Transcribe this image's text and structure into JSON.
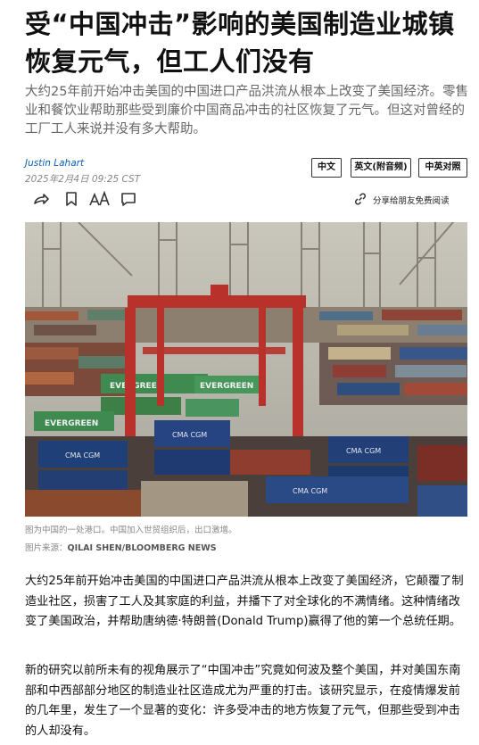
{
  "article": {
    "headline": "受“中国冲击”影响的美国制造业城镇恢复元气，但工人们没有",
    "dek": "大约25年前开始冲击美国的中国进口产品洪流从根本上改变了美国经济。零售业和餐饮业帮助那些受到廉价中国商品冲击的社区恢复了元气。但这对曾经的工厂工人来说并没有多大帮助。",
    "author": "Justin Lahart",
    "date": "2025年2月4日 09:25 CST",
    "languages": [
      "中文",
      "英文(附音频)",
      "中英对照"
    ],
    "toolbar": {
      "icons": [
        "share-arrow-icon",
        "bookmark-icon",
        "text-size-icon",
        "comment-icon"
      ],
      "gift_label": "分享给朋友免费阅读"
    },
    "photo": {
      "caption": "图为中国的一处港口。中国加入世贸组织后，出口激增。",
      "credit_prefix": "图片来源：",
      "credit_name": "QILAI SHEN/BLOOMBERG NEWS",
      "container_texts": [
        "EVERGREEN",
        "CMA CGM"
      ]
    },
    "paragraphs": [
      "大约25年前开始冲击美国的中国进口产品洪流从根本上改变了美国经济，它颠覆了制造业社区，损害了工人及其家庭的利益，并播下了对全球化的不满情绪。这种情绪改变了美国政治，并帮助唐纳德·特朗普(Donald Trump)赢得了他的第一个总统任期。",
      "新的研究以前所未有的视角展示了“中国冲击”究竟如何波及整个美国，并对美国东南部和中西部部分地区的制造业社区造成尤为严重的打击。该研究显示，在疫情爆发前的几年里，发生了一个显著的变化：许多受冲击的地方恢复了元气，但那些受到冲击的人却没有。"
    ]
  },
  "colors": {
    "author_link": "#0a5fb4",
    "muted_text": "#666666",
    "crane_red": "#b8322b"
  }
}
